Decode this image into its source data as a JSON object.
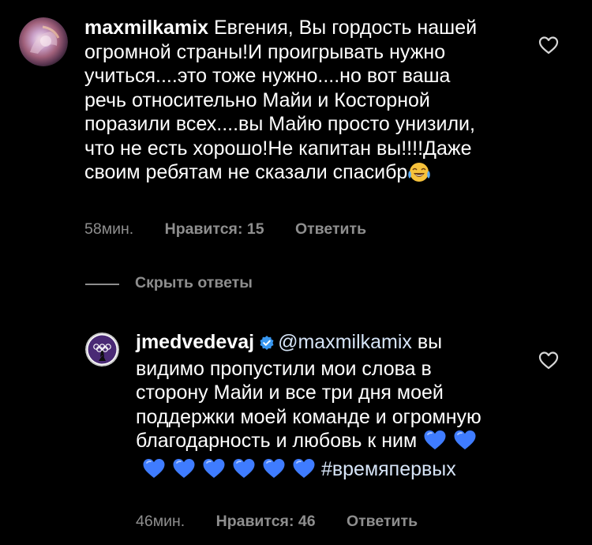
{
  "comments": [
    {
      "username": "maxmilkamix",
      "text": "Евгения, Вы гордость нашей огромной страны!И проигрывать нужно учиться....это тоже нужно....но вот ваша речь относительно Майи и Косторной поразили всех....вы Майю просто унизили, что не есть хорошо!Не капитан вы!!!!Даже своим ребятам не сказали спасибр",
      "emoji": "face-with-tears-of-joy-icon",
      "time": "58мин.",
      "likes": "Нравится: 15",
      "reply_label": "Ответить"
    }
  ],
  "replies_toggle": {
    "label": "Скрыть ответы"
  },
  "replies": [
    {
      "username": "jmedvedevaj",
      "verified": true,
      "mention": "@maxmilkamix",
      "text": " вы видимо пропустили мои слова в сторону Майи и все три дня моей поддержки моей команде и огромную благодарность и любовь к ним",
      "emoji_count": 8,
      "hashtag": "#времяпервых",
      "time": "46мин.",
      "likes": "Нравится: 46",
      "reply_label": "Ответить"
    }
  ],
  "colors": {
    "background": "#000000",
    "text": "#ffffff",
    "meta": "#8e8e8e",
    "link": "#d6e4f7",
    "verified_badge": "#3897f0",
    "blue_heart": "#3f7cff"
  }
}
